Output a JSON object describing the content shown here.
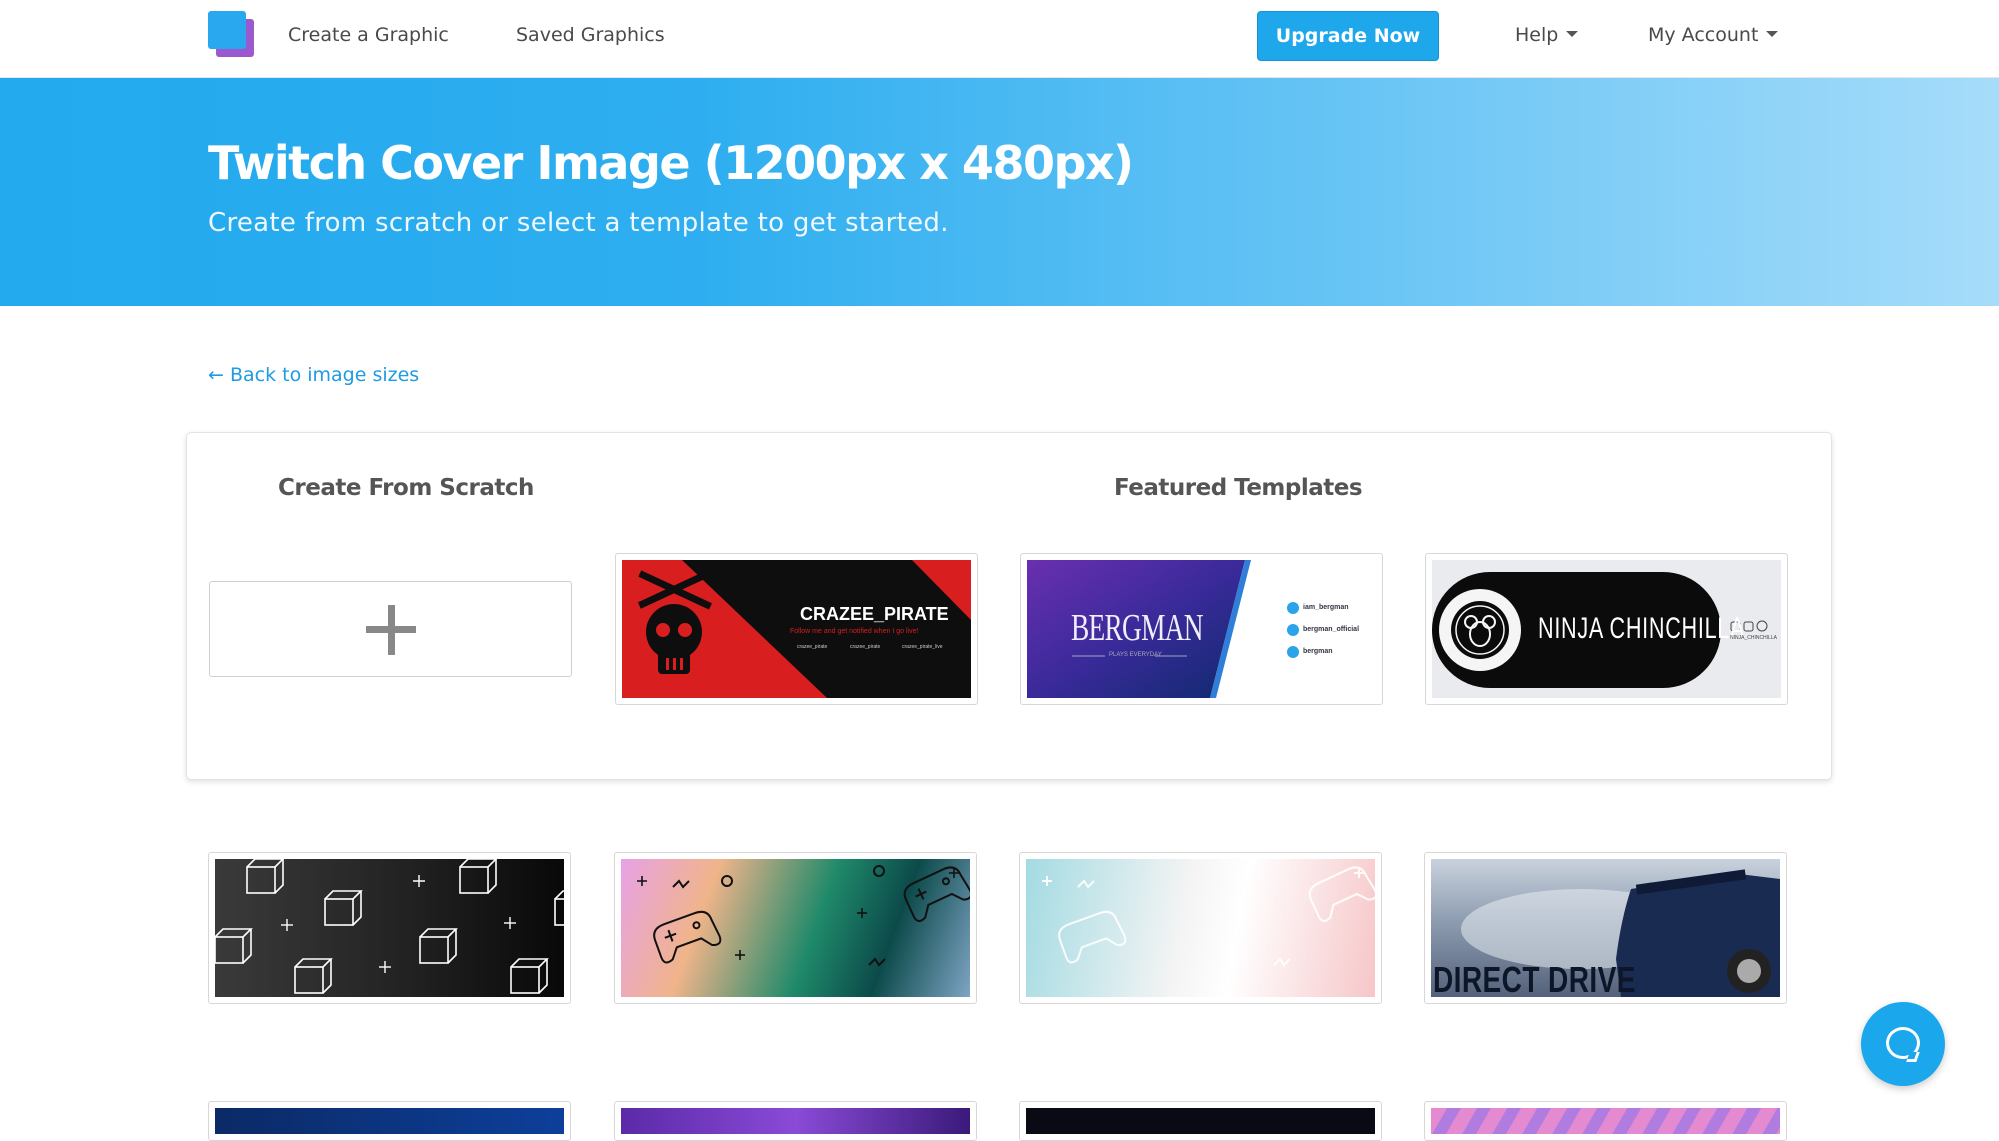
{
  "nav": {
    "create_graphic": "Create a Graphic",
    "saved_graphics": "Saved Graphics",
    "upgrade": "Upgrade Now",
    "help": "Help",
    "my_account": "My Account"
  },
  "hero": {
    "title": "Twitch Cover Image (1200px x 480px)",
    "subtitle": "Create from scratch or select a template to get started."
  },
  "back_link": "← Back to image sizes",
  "card": {
    "scratch_heading": "Create From Scratch",
    "featured_heading": "Featured Templates"
  },
  "templates": {
    "crazee": {
      "name": "CRAZEE_PIRATE",
      "tagline": "Follow me and get notified when I go live!",
      "handles": [
        "crazee_pirate",
        "crazee_pirate",
        "crazee_pirate_live"
      ]
    },
    "bergman": {
      "name": "BERGMAN",
      "tagline": "PLAYS EVERYDAY",
      "handles": [
        "iam_bergman",
        "bergman_official",
        "bergman"
      ]
    },
    "ninja": {
      "name": "NINJA CHINCHILLA",
      "handle": "NINJA_CHINCHILLA"
    },
    "drive": {
      "name": "DIRECT DRIVE"
    }
  },
  "colors": {
    "accent": "#1ea7ea",
    "brand_purple": "#9b59d0",
    "crazee_red": "#d81e1e"
  }
}
